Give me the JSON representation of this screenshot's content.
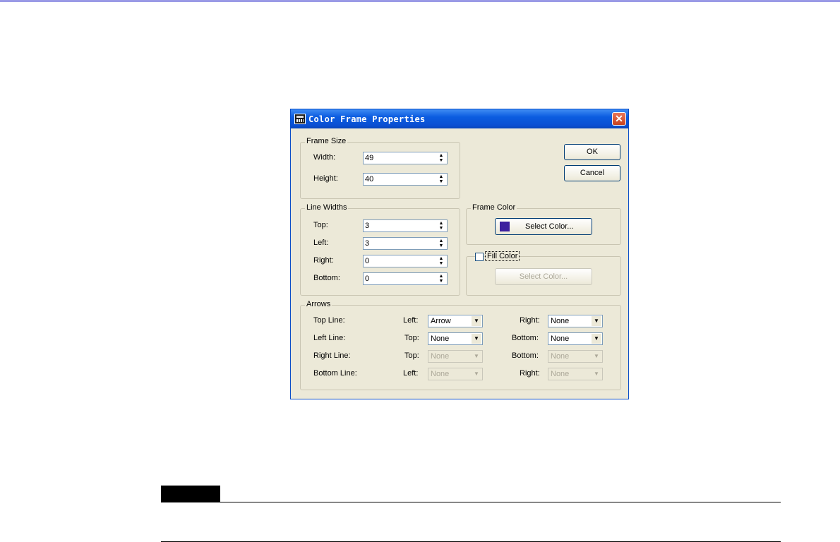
{
  "dialog": {
    "title": "Color Frame Properties",
    "close_glyph": "✕",
    "frame_size": {
      "label": "Frame Size",
      "width_label": "Width:",
      "width_value": "49",
      "height_label": "Height:",
      "height_value": "40"
    },
    "buttons": {
      "ok": "OK",
      "cancel": "Cancel"
    },
    "line_widths": {
      "label": "Line Widths",
      "top_label": "Top:",
      "top_value": "3",
      "left_label": "Left:",
      "left_value": "3",
      "right_label": "Right:",
      "right_value": "0",
      "bottom_label": "Bottom:",
      "bottom_value": "0"
    },
    "frame_color": {
      "label": "Frame Color",
      "button": "Select Color...",
      "swatch_color": "#3c1f9e"
    },
    "fill_color": {
      "label": "Fill Color",
      "checked": false,
      "button": "Select Color..."
    },
    "arrows": {
      "label": "Arrows",
      "rows": [
        {
          "name": "Top Line:",
          "a_label": "Left:",
          "a_value": "Arrow",
          "b_label": "Right:",
          "b_value": "None"
        },
        {
          "name": "Left Line:",
          "a_label": "Top:",
          "a_value": "None",
          "b_label": "Bottom:",
          "b_value": "None"
        },
        {
          "name": "Right Line:",
          "a_label": "Top:",
          "a_value": "None",
          "b_label": "Bottom:",
          "b_value": "None"
        },
        {
          "name": "Bottom Line:",
          "a_label": "Left:",
          "a_value": "None",
          "b_label": "Right:",
          "b_value": "None"
        }
      ]
    }
  }
}
